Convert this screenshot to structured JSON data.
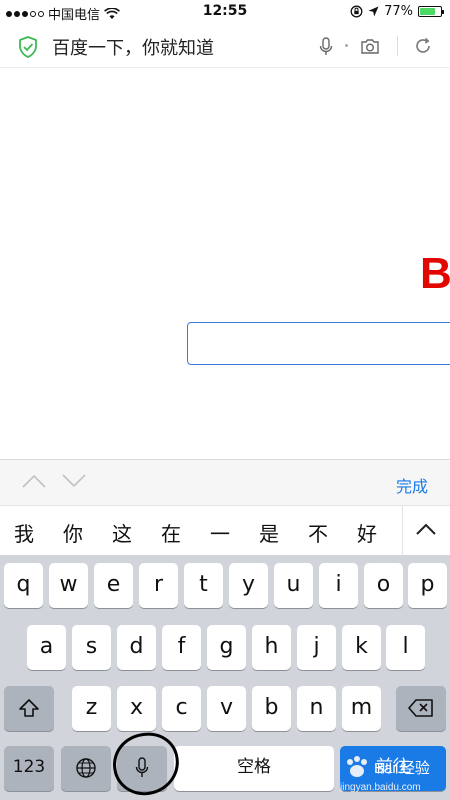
{
  "status": {
    "carrier": "中国电信",
    "time": "12:55",
    "battery": "77%",
    "battery_level": 0.77
  },
  "address_bar": {
    "title": "百度一下，你就知道",
    "icons": [
      "shield-check-icon",
      "mic-icon",
      "camera-icon",
      "reload-icon"
    ]
  },
  "page": {
    "logo_fragment": "B",
    "logo_color": "#e10600",
    "search_value": ""
  },
  "accessory": {
    "done_label": "完成"
  },
  "candidates": [
    "我",
    "你",
    "这",
    "在",
    "一",
    "是",
    "不",
    "好"
  ],
  "keyboard": {
    "row1": [
      "q",
      "w",
      "e",
      "r",
      "t",
      "y",
      "u",
      "i",
      "o",
      "p"
    ],
    "row2": [
      "a",
      "s",
      "d",
      "f",
      "g",
      "h",
      "j",
      "k",
      "l"
    ],
    "row3": [
      "z",
      "x",
      "c",
      "v",
      "b",
      "n",
      "m"
    ],
    "numbers_label": "123",
    "space_label": "空格",
    "enter_label": "前往"
  },
  "watermark": {
    "text": "Bai 经验",
    "sub": "jingyan.baidu.com"
  },
  "colors": {
    "accent": "#1a7be6",
    "keyboard_bg": "#d1d5db"
  }
}
